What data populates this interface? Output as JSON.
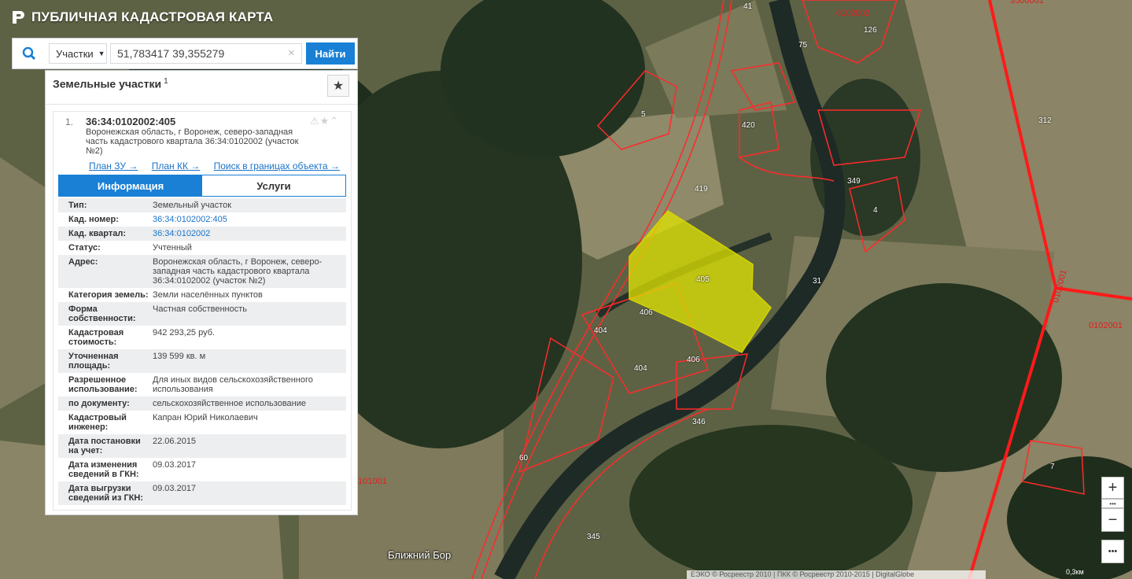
{
  "app": {
    "title": "ПУБЛИЧНАЯ КАДАСТРОВАЯ КАРТА"
  },
  "search": {
    "type_label": "Участки",
    "query": "51,783417 39,355279",
    "button": "Найти",
    "clear": "×"
  },
  "panel": {
    "title": "Земельные участки",
    "count": "1",
    "result": {
      "index": "1.",
      "cad_number": "36:34:0102002:405",
      "address": "Воронежская область, г Воронеж, северо-западная часть кадастрового квартала 36:34:0102002 (участок №2)",
      "links": [
        "План ЗУ →",
        "План КК →",
        "Поиск в границах объекта →"
      ]
    },
    "tabs": [
      "Информация",
      "Услуги"
    ],
    "info": [
      {
        "k": "Тип:",
        "v": "Земельный участок"
      },
      {
        "k": "Кад. номер:",
        "v": "36:34:0102002:405",
        "link": true
      },
      {
        "k": "Кад. квартал:",
        "v": "36:34:0102002",
        "link": true
      },
      {
        "k": "Статус:",
        "v": "Учтенный"
      },
      {
        "k": "Адрес:",
        "v": "Воронежская область, г Воронеж, северо-западная часть кадастрового квартала 36:34:0102002 (участок №2)"
      },
      {
        "k": "Категория земель:",
        "v": "Земли населённых пунктов"
      },
      {
        "k": "Форма собственности:",
        "v": "Частная собственность"
      },
      {
        "k": "Кадастровая стоимость:",
        "v": "942 293,25 руб."
      },
      {
        "k": "Уточненная площадь:",
        "v": "139 599 кв. м"
      },
      {
        "k": "Разрешенное использование:",
        "v": "Для иных видов сельскохозяйственного использования"
      },
      {
        "k": "по документу:",
        "v": "сельскохозяйственное использование"
      },
      {
        "k": "Кадастровый инженер:",
        "v": "Капран Юрий Николаевич"
      },
      {
        "k": "Дата постановки на учет:",
        "v": "22.06.2015"
      },
      {
        "k": "Дата изменения сведений в ГКН:",
        "v": "09.03.2017"
      },
      {
        "k": "Дата выгрузки сведений из ГКН:",
        "v": "09.03.2017"
      }
    ]
  },
  "map": {
    "place": "Ближний Бор",
    "attribution": "ЕЭКО © Росреестр 2010 | ПКК © Росреестр 2010-2015 | DigitalGlobe",
    "scale": "0,3км",
    "quarters": [
      "0102002",
      "0102001",
      "0102001",
      "101001",
      "3500001"
    ],
    "parcels": [
      "41",
      "420",
      "419",
      "349",
      "4",
      "405",
      "406",
      "404",
      "346",
      "60",
      "345",
      "5",
      "312",
      "7",
      "31",
      "126",
      "75"
    ]
  },
  "controls": {
    "zoom_in": "+",
    "zoom_out": "−",
    "more": "•••"
  }
}
